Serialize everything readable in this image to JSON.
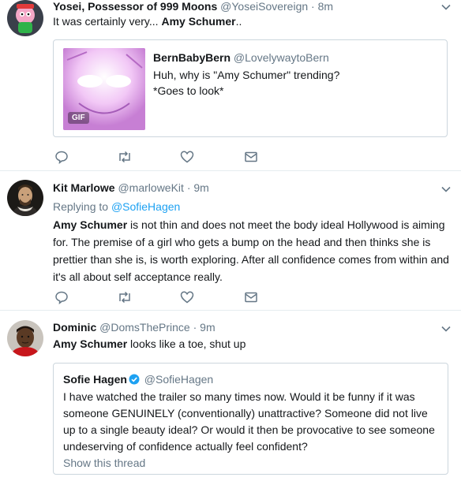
{
  "tweets": [
    {
      "name": "Yosei, Possessor of 999 Moons",
      "handle": "@YoseiSovereign",
      "time": "8m",
      "text_prefix": "It was certainly very... ",
      "text_bold": "Amy Schumer",
      "text_suffix": "..",
      "quote": {
        "name": "BernBabyBern",
        "handle": "@LovelywaytoBern",
        "line1": "Huh, why is \"Amy Schumer\" trending?",
        "line2": "*Goes to look*",
        "badge": "GIF"
      }
    },
    {
      "name": "Kit Marlowe",
      "handle": "@marloweKit",
      "time": "9m",
      "replying_label": "Replying to",
      "replying_to": "@SofieHagen",
      "text_bold": "Amy Schumer",
      "text_rest": " is not thin and does not meet the body ideal Hollywood is aiming for. The premise of a girl who gets a bump on the head and then thinks she is prettier than she is, is worth exploring.  After all confidence comes from within and it's all about self acceptance really."
    },
    {
      "name": "Dominic",
      "handle": "@DomsThePrince",
      "time": "9m",
      "text_bold": "Amy Schumer",
      "text_rest": " looks like a toe, shut up",
      "quote": {
        "name": "Sofie Hagen",
        "handle": "@SofieHagen",
        "text": "I have watched the trailer so many times now. Would it be funny if it was someone GENUINELY (conventionally) unattractive? Someone did not live up to a single beauty ideal? Or would it then be provocative to see someone undeserving of confidence actually feel confident?",
        "show_thread": "Show this thread"
      }
    }
  ],
  "separator": "·",
  "icons": [
    "reply-icon",
    "retweet-icon",
    "like-icon",
    "message-icon",
    "chevron-down-icon",
    "verified-icon"
  ],
  "colors": {
    "name": "#14171a",
    "secondary": "#657786",
    "link": "#1da1f2",
    "border": "#e6ecf0",
    "quote_border": "#ccd6dd",
    "verified": "#1da1f2"
  }
}
